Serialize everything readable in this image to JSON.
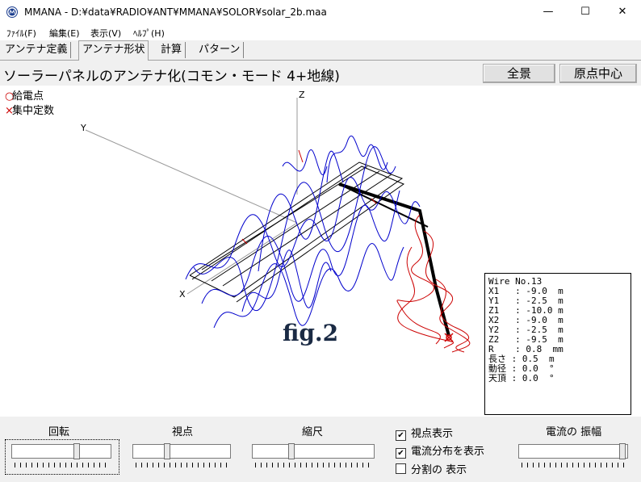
{
  "window": {
    "title": "MMANA - D:¥data¥RADIO¥ANT¥MMANA¥SOLOR¥solar_2b.maa",
    "minimize_glyph": "—",
    "maximize_glyph": "☐",
    "close_glyph": "✕"
  },
  "menu": [
    "ﾌｧｲﾙ(F)",
    "編集(E)",
    "表示(V)",
    "ﾍﾙﾌﾟ(H)"
  ],
  "tabs": [
    "アンテナ定義",
    "アンテナ形状",
    "計算",
    "パターン"
  ],
  "active_tab": "アンテナ形状",
  "view": {
    "title": "ソーラーパネルのアンテナ化(コモン・モード 4+地線)",
    "fit_button": "全景",
    "origin_button": "原点中心",
    "legend": {
      "feed_point": "給電点",
      "lumped_constants": "集中定数"
    },
    "axis_x": "X",
    "axis_y": "Y",
    "axis_z": "Z",
    "fig_label": "fig.2",
    "colors": {
      "wire": "#000000",
      "current_1": "#0000cc",
      "current_2": "#cc0000",
      "axis": "#888888",
      "feed_marker": "#cc0000"
    }
  },
  "wire_info": {
    "lines": [
      "Wire No.13",
      "X1   : -9.0  m",
      "Y1   : -2.5  m",
      "Z1   : -10.0 m",
      "X2   : -9.0  m",
      "Y2   : -2.5  m",
      "Z2   : -9.5  m",
      "R    : 0.8  mm",
      "長さ : 0.5  m",
      "動径 : 0.0  °",
      "天頂 : 0.0  °"
    ]
  },
  "controls": {
    "rotate_label": "回転",
    "viewpoint_label": "視点",
    "scale_label": "縮尺",
    "current_amplitude_label": "電流の 振幅",
    "checkboxes": [
      {
        "label": "視点表示",
        "checked": true
      },
      {
        "label": "電流分布を表示",
        "checked": true
      },
      {
        "label": "分割の 表示",
        "checked": false
      }
    ]
  }
}
